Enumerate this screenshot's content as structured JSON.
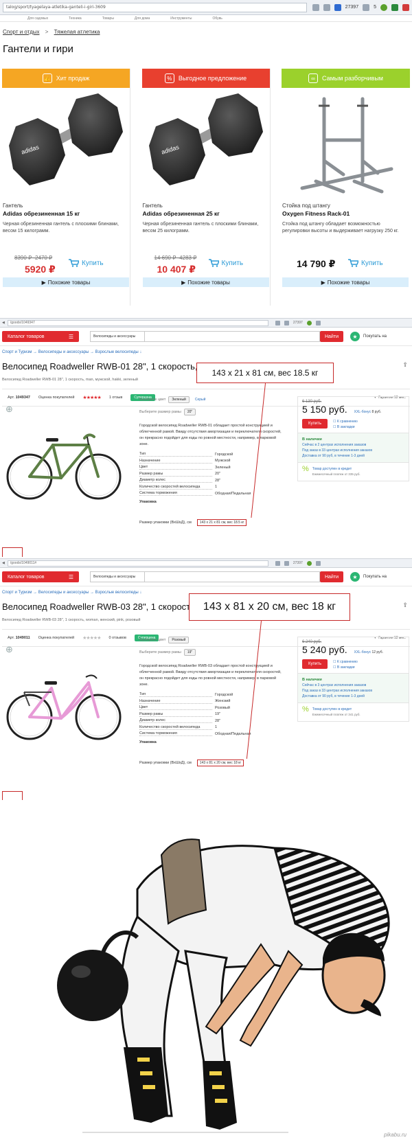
{
  "catalog": {
    "url": "talog/sport/tyagelaya-atletika-ganteli-i-giri-3609",
    "tab_count": "27397",
    "weather": "5",
    "nav_items": [
      "Для садовых",
      "Техника",
      "Товары",
      "Для дома",
      "Инструменты",
      "Обувь"
    ],
    "breadcrumb": [
      "Спорт и отдых",
      "Тяжелая атлетика"
    ],
    "title": "Гантели и гири",
    "cards": [
      {
        "ribbon": "Хит продаж",
        "category": "Гантель",
        "name": "Adidas обрезиненная 15 кг",
        "description": "Черная обрезиненная гантель с плоскими блинами, весом 15 килограмм.",
        "old_prices": "8390 ₽ -2470 ₽",
        "price": "5920 ₽",
        "buy": "Купить",
        "similar": "Похожие товары"
      },
      {
        "ribbon": "Выгодное предложение",
        "category": "Гантель",
        "name": "Adidas обрезиненная 25 кг",
        "description": "Черная обрезиненная гантель с плоскими блинами, весом 25 килограмм.",
        "old_prices": "14 690 ₽ -4283 ₽",
        "price": "10 407 ₽",
        "buy": "Купить",
        "similar": "Похожие товары"
      },
      {
        "ribbon": "Самым разборчивым",
        "category": "Стойка под штангу",
        "name": "Oxygen Fitness Rack-01",
        "description": "Стойка под штангу обладает возможностью регулировки высоты и выдерживает нагрузку 250 кг.",
        "old_prices": "",
        "price": "14 790 ₽",
        "buy": "Купить",
        "similar": "Похожие товары"
      }
    ]
  },
  "bike1": {
    "url": "/goods/1049347",
    "tab_count": "27397",
    "catalog_btn": "Каталог товаров",
    "category_select": "Велосипеды и аксессуары",
    "find": "Найти",
    "buy_on": "Покупать на",
    "breadcrumb": "Спорт и Туризм → Велосипеды и аксессуары → Взрослые велосипеды ↓",
    "title": "Велосипед Roadweller RWB-01 28\", 1 скорость, мужской, зеленый",
    "subtitle": "Велосипед Roadweller RWB-01 28\", 1 скорость, man, мужской, hakki, зеленый",
    "art_label": "Арт.",
    "art": "1049347",
    "rating_label": "Оценка покупателей",
    "stars": "★★★★★",
    "reviews": "1 отзыв",
    "badge": "Суперцена",
    "guarantee": "Гарантия 12 мес.",
    "color_label": "Выберите цвет",
    "color_selected": "Зеленый",
    "color_other": "Серый",
    "size_label": "Выберите размер рамы",
    "size_value": "20\"",
    "description": "Городской велосипед Roadweller RWB-01 обладает простой конструкцией и облегченной рамой. Ввиду отсутствия амортизации и переключателя скоростей, он прекрасно подойдет для езды по ровной местности, например, в парковой зоне.",
    "specs": [
      {
        "k": "Тип",
        "v": "Городской"
      },
      {
        "k": "Назначение",
        "v": "Мужской"
      },
      {
        "k": "Цвет",
        "v": "Зеленый"
      },
      {
        "k": "Размер рамы",
        "v": "20\""
      },
      {
        "k": "Диаметр колес",
        "v": "28\""
      },
      {
        "k": "Количество скоростей велосипеда",
        "v": "1"
      },
      {
        "k": "Система торможения",
        "v": "Ободная/Педальная"
      }
    ],
    "pack_heading": "Упаковка",
    "pack_label": "Размер упаковки (ВхШхД), см",
    "pack_value": "143 х 21 х 81 см, вес 18.5 кг",
    "callout": "143 х 21 х 81 см, вес 18.5 кг",
    "old_price": "6 130 руб.",
    "price": "5 150 руб.",
    "bonus_label": "XXL-бонус",
    "bonus": "8 руб.",
    "buy": "Купить",
    "compare": "К сравнению",
    "favorites": "В закладки",
    "stock_title": "В наличии",
    "stock_lines": [
      "Сейчас в 2 центрах исполнения заказов",
      "Под заказ в 33 центрах исполнения заказов",
      "Доставка от 90 руб, в течение 1-3 дней"
    ],
    "credit": "Товар доступен в кредит",
    "credit_sub": "Ежемесячный платеж от 335 руб."
  },
  "bike2": {
    "url": "/goods/1049011#",
    "tab_count": "27397",
    "catalog_btn": "Каталог товаров",
    "category_select": "Велосипеды и аксессуары",
    "find": "Найти",
    "buy_on": "Покупать на",
    "breadcrumb": "Спорт и Туризм → Велосипеды и аксессуары → Взрослые велосипеды ↓",
    "title": "Велосипед Roadweller RWB-03 28\", 1 скорость, женский, розовый",
    "subtitle": "Велосипед Roadweller RWB-03 28\", 1 скорость, woman, женский, pink, розовый",
    "art_label": "Арт.",
    "art": "1049011",
    "rating_label": "Оценка покупателей",
    "stars": "★★★★★",
    "reviews": "0 отзывов",
    "badge": "Суперцена",
    "guarantee": "Гарантия 12 мес.",
    "color_label": "Выберите цвет",
    "color_selected": "Розовый",
    "color_other": "",
    "size_label": "Выберите размер рамы",
    "size_value": "19\"",
    "description": "Городской велосипед Roadweller RWB-03 обладает простой конструкцией и облегченной рамой. Ввиду отсутствия амортизации и переключателя скоростей, он прекрасно подойдет для езды по ровной местности, например, в парковой зоне.",
    "specs": [
      {
        "k": "Тип",
        "v": "Городской"
      },
      {
        "k": "Назначение",
        "v": "Женский"
      },
      {
        "k": "Цвет",
        "v": "Розовый"
      },
      {
        "k": "Размер рамы",
        "v": "19\""
      },
      {
        "k": "Диаметр колес",
        "v": "28\""
      },
      {
        "k": "Количество скоростей велосипеда",
        "v": "1"
      },
      {
        "k": "Система торможения",
        "v": "Ободная/Педальная"
      }
    ],
    "pack_heading": "Упаковка",
    "pack_label": "Размер упаковки (ВхШхД), см",
    "pack_value": "143 х 81 х 20 см, вес 18 кг",
    "callout": "143 х 81 х 20 см, вес 18 кг",
    "old_price": "6 240 руб.",
    "price": "5 240 руб.",
    "bonus_label": "XXL-бонус",
    "bonus": "12 руб.",
    "buy": "Купить",
    "compare": "К сравнению",
    "favorites": "В закладки",
    "stock_title": "В наличии",
    "stock_lines": [
      "Сейчас в 3 центрах исполнения заказов",
      "Под заказ в 33 центрах исполнения заказов",
      "Доставка от 90 руб, в течение 1-3 дней"
    ],
    "credit": "Товар доступен в кредит",
    "credit_sub": "Ежемесячный платеж от 341 руб."
  },
  "illustration": {
    "watermark": "pikabu.ru"
  },
  "colors": {
    "accent_red": "#e02a2f",
    "callout_red": "#c62828",
    "link_blue": "#2a6ebb",
    "green": "#2bb673",
    "bike1_frame": "#5d7f45",
    "bike2_frame": "#e79ad6"
  }
}
